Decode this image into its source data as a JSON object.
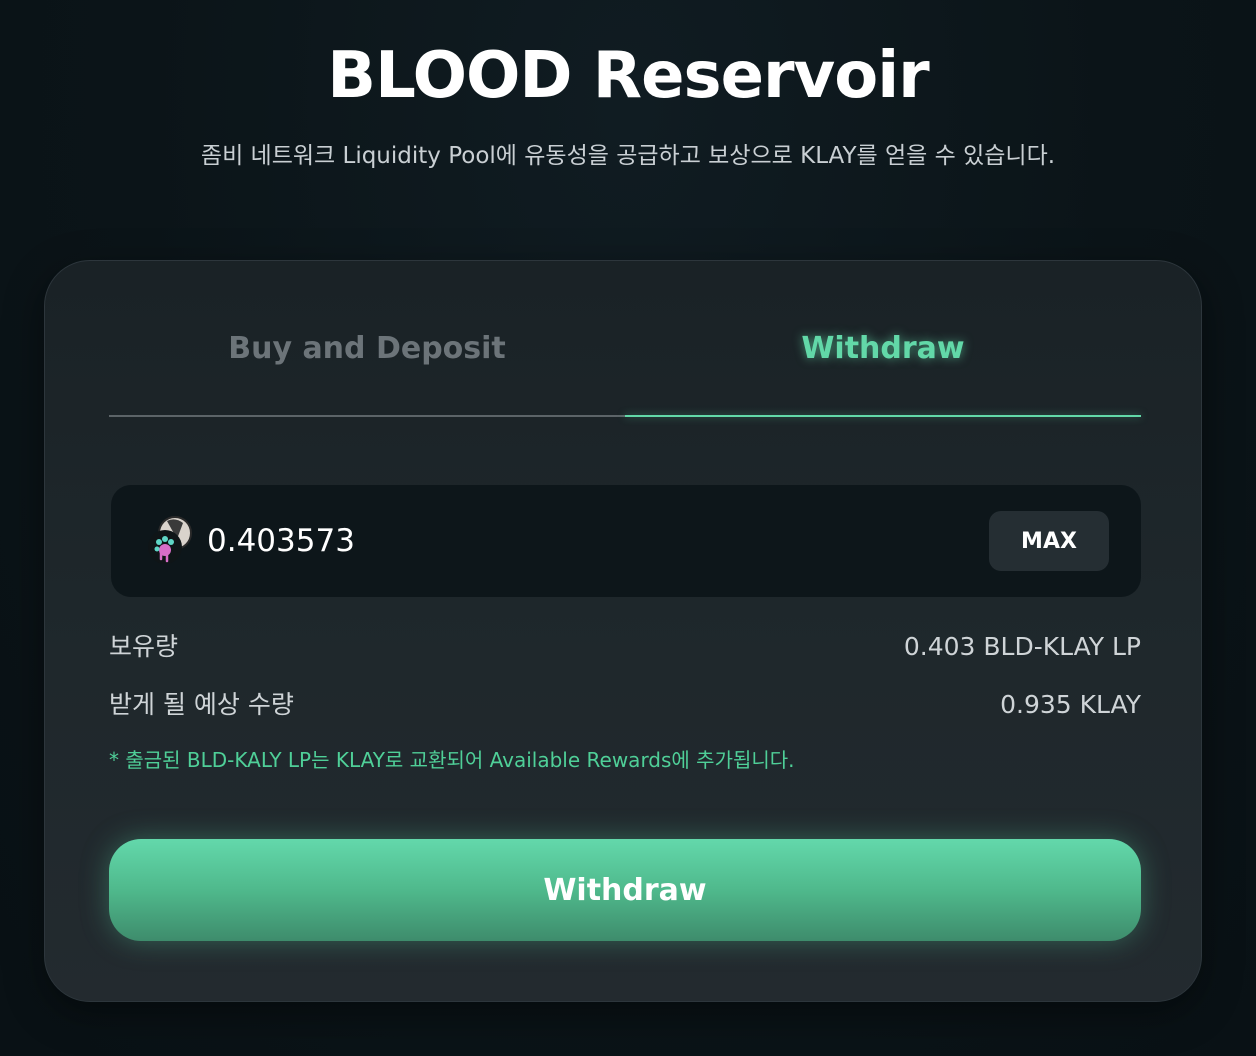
{
  "header": {
    "title": "BLOOD Reservoir",
    "subtitle": "좀비 네트워크 Liquidity Pool에 유동성을 공급하고 보상으로 KLAY를 얻을 수 있습니다."
  },
  "tabs": [
    {
      "label": "Buy and Deposit",
      "active": false
    },
    {
      "label": "Withdraw",
      "active": true
    }
  ],
  "input": {
    "token_icon": "zombie-paw-token-icon",
    "value": "0.403573",
    "max_label": "MAX"
  },
  "info": {
    "holding_label": "보유량",
    "holding_value": "0.403 BLD-KLAY LP",
    "expected_label": "받게 될 예상 수량",
    "expected_value": "0.935 KLAY"
  },
  "note": "* 출금된 BLD-KALY LP는 KLAY로 교환되어 Available Rewards에 추가됩니다.",
  "action": {
    "withdraw_label": "Withdraw"
  },
  "colors": {
    "accent": "#62d8a8",
    "background": "#0c151a",
    "card": "#1f282c"
  }
}
